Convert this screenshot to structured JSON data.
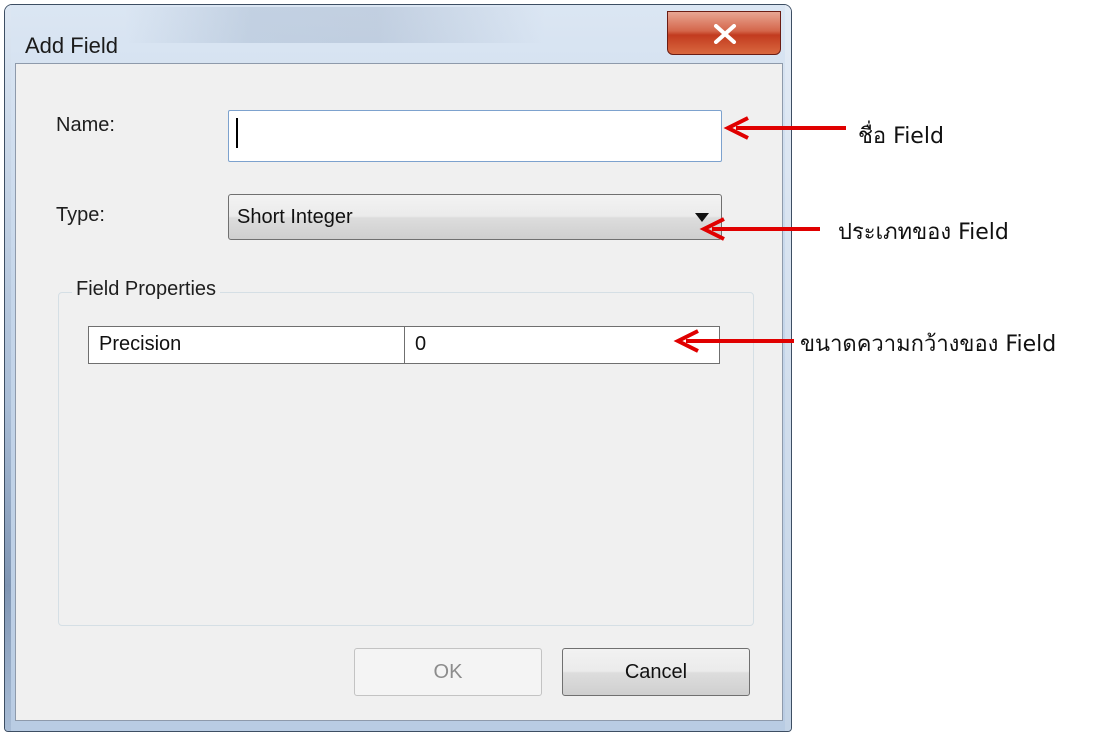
{
  "dialog": {
    "title": "Add Field",
    "close_icon": "close-x-icon",
    "name_label": "Name:",
    "name_value": "",
    "type_label": "Type:",
    "type_value": "Short Integer",
    "group_title": "Field Properties",
    "properties": [
      {
        "key": "Precision",
        "value": "0"
      }
    ],
    "ok_label": "OK",
    "cancel_label": "Cancel"
  },
  "annotations": {
    "name_note": "ชื่อ Field",
    "type_note": "ประเภทของ Field",
    "precision_note": "ขนาดความกว้างของ Field"
  },
  "colors": {
    "arrow": "#e00000",
    "close_button": "#c8452a",
    "input_border": "#7da2ce"
  }
}
